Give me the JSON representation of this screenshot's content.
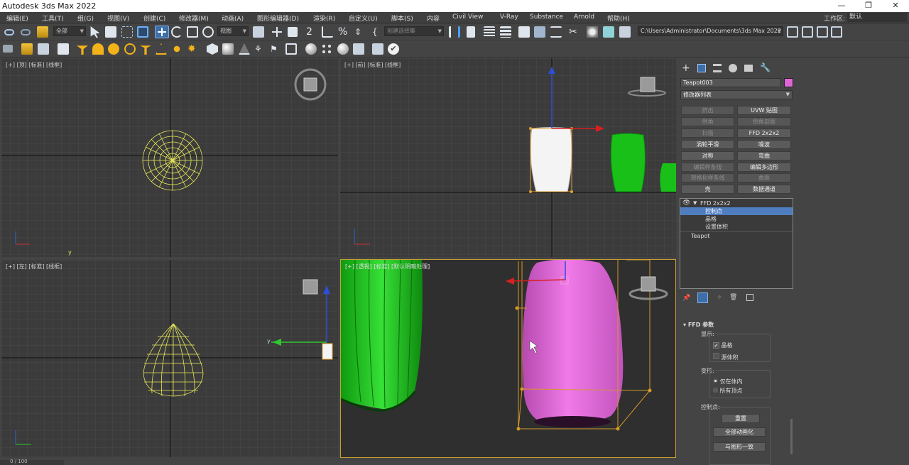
{
  "window": {
    "title": "Autodesk 3ds Max 2022",
    "controls": [
      "—",
      "❐",
      "✕"
    ]
  },
  "menu": {
    "items": [
      "编辑(E)",
      "工具(T)",
      "组(G)",
      "视图(V)",
      "创建(C)",
      "修改器(M)",
      "动画(A)",
      "图形编辑器(D)",
      "渲染(R)",
      "自定义(U)",
      "脚本(S)",
      "内容",
      "Civil View",
      "V-Ray",
      "Substance",
      "Arnold",
      "帮助(H)"
    ],
    "workspace_label": "工作区:",
    "workspace_value": "默认"
  },
  "toolbar": {
    "selection_filter": "全部",
    "reference_coord": "视图",
    "named_selection_placeholder": "创建选择集",
    "project_path": "C:\\Users\\Administrator\\Documents\\3ds Max 2022"
  },
  "viewports": {
    "top_left_label": "[+] [顶] [标准] [线框]",
    "top_right_label": "[+] [前] [标准] [线框]",
    "bottom_left_label": "[+] [左] [标准] [线框]",
    "bottom_right_label": "[+] [透视] [标准] [默认明暗处理]",
    "axis_y": "y",
    "axis_y2": "y"
  },
  "command_panel": {
    "object_name": "Teapot003",
    "object_color": "#e066d8",
    "modifier_list": "修改器列表",
    "buttons": [
      {
        "label": "挤出",
        "enabled": false
      },
      {
        "label": "UVW 贴图",
        "enabled": true
      },
      {
        "label": "倒角",
        "enabled": false
      },
      {
        "label": "倒角剖面",
        "enabled": false
      },
      {
        "label": "扫描",
        "enabled": false
      },
      {
        "label": "FFD 2x2x2",
        "enabled": true
      },
      {
        "label": "涡轮平滑",
        "enabled": true
      },
      {
        "label": "噪波",
        "enabled": true
      },
      {
        "label": "对称",
        "enabled": true
      },
      {
        "label": "弯曲",
        "enabled": true
      },
      {
        "label": "编辑样条线",
        "enabled": false
      },
      {
        "label": "编辑多边形",
        "enabled": true
      },
      {
        "label": "规格化样条线",
        "enabled": false
      },
      {
        "label": "曲面",
        "enabled": false
      },
      {
        "label": "壳",
        "enabled": true
      },
      {
        "label": "数据通道",
        "enabled": true
      }
    ],
    "stack": {
      "modifier": "FFD 2x2x2",
      "subs": [
        "控制点",
        "晶格",
        "设置体积"
      ],
      "selected_sub": "控制点",
      "base": "Teapot"
    },
    "ffd_params": {
      "title": "FFD 参数",
      "display_label": "显示:",
      "lattice": "晶格",
      "lattice_checked": true,
      "source_volume": "源体积",
      "source_volume_checked": false,
      "deform_label": "变形:",
      "only_in_volume": "仅在体内",
      "all_vertices": "所有顶点",
      "control_points_label": "控制点:",
      "reset": "重置",
      "animate_all": "全部动画化",
      "conform_to_shape": "与图形一致"
    }
  },
  "status": {
    "frame": "0 / 100"
  }
}
